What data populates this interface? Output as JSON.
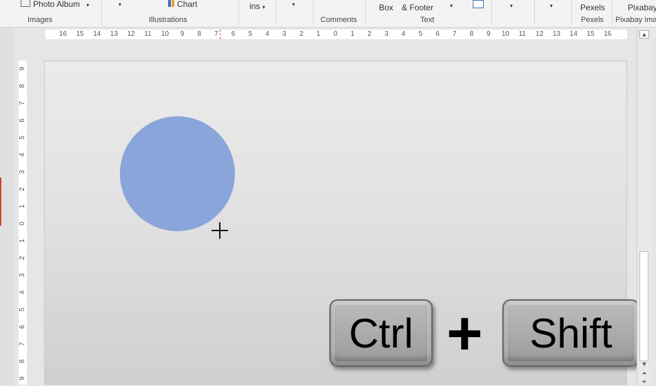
{
  "ribbon": {
    "photo_album": "Photo Album",
    "chart": "Chart",
    "addins": "ins",
    "textbox": "Box",
    "header_footer": "& Footer",
    "pexels": "Pexels",
    "pixabay": "Pixabay",
    "groups": {
      "images": "Images",
      "illustrations": "Illustrations",
      "comments": "Comments",
      "text": "Text",
      "pexels": "Pexels",
      "pixabay": "Pixabay Ima"
    },
    "chart_icon_colors": [
      "#e8a33c",
      "#3c6fb6"
    ]
  },
  "hruler": [
    "16",
    "15",
    "14",
    "13",
    "12",
    "11",
    "10",
    "9",
    "8",
    "7",
    "6",
    "5",
    "4",
    "3",
    "2",
    "1",
    "0",
    "1",
    "2",
    "3",
    "4",
    "5",
    "6",
    "7",
    "8",
    "9",
    "10",
    "11",
    "12",
    "13",
    "14",
    "15",
    "16"
  ],
  "vruler": [
    "9",
    "8",
    "7",
    "6",
    "5",
    "4",
    "3",
    "2",
    "1",
    "0",
    "1",
    "2",
    "3",
    "4",
    "5",
    "6",
    "7",
    "8",
    "9"
  ],
  "slide": {
    "circle_color": "#8aa5d9",
    "keys": {
      "ctrl": "Ctrl",
      "plus": "+",
      "shift": "Shift"
    }
  },
  "cursor": "crosshair-icon"
}
